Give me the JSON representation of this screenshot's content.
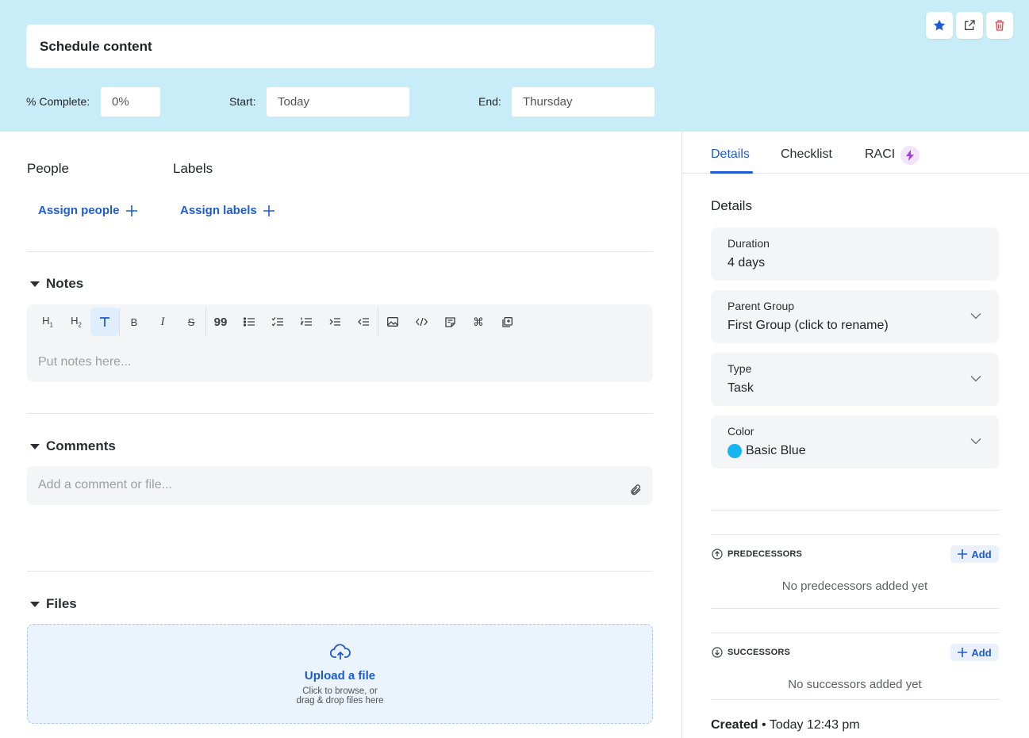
{
  "header": {
    "title": "Schedule content",
    "complete_label": "% Complete:",
    "complete_value": "0%",
    "start_label": "Start:",
    "start_value": "Today",
    "end_label": "End:",
    "end_value": "Thursday",
    "actions": [
      "star-icon",
      "open-external-icon",
      "trash-icon"
    ]
  },
  "people": {
    "heading": "People",
    "action": "Assign people"
  },
  "labels": {
    "heading": "Labels",
    "action": "Assign labels"
  },
  "notes": {
    "heading": "Notes",
    "toolbar": [
      "heading-1",
      "heading-2",
      "text",
      "bold",
      "italic",
      "strikethrough",
      "quote",
      "bullet-list",
      "check-list",
      "numbered-list",
      "indent",
      "outdent",
      "image",
      "code",
      "note",
      "command",
      "embed"
    ],
    "toolbar_active": "text",
    "placeholder": "Put notes here..."
  },
  "comments": {
    "heading": "Comments",
    "placeholder": "Add a comment or file..."
  },
  "files": {
    "heading": "Files",
    "upload_title": "Upload a file",
    "upload_line1": "Click to browse, or",
    "upload_line2": "drag & drop files here"
  },
  "tabs": [
    {
      "label": "Details",
      "active": true
    },
    {
      "label": "Checklist",
      "active": false
    },
    {
      "label": "RACI",
      "active": false
    }
  ],
  "details": {
    "heading": "Details",
    "duration_label": "Duration",
    "duration_value": "4 days",
    "parent_label": "Parent Group",
    "parent_value": "First Group (click to rename)",
    "type_label": "Type",
    "type_value": "Task",
    "color_label": "Color",
    "color_value": "Basic Blue",
    "color_swatch": "#15b5ef"
  },
  "predecessors": {
    "heading": "PREDECESSORS",
    "add": "Add",
    "empty": "No predecessors added yet"
  },
  "successors": {
    "heading": "SUCCESSORS",
    "add": "Add",
    "empty": "No successors added yet"
  },
  "created": {
    "label": "Created",
    "separator": "•",
    "value": "Today 12:43 pm"
  },
  "colors": {
    "header_bg": "#c9edf8",
    "accent": "#1d5bd6",
    "danger": "#e0484f",
    "raci_badge": "#a63fe0"
  }
}
